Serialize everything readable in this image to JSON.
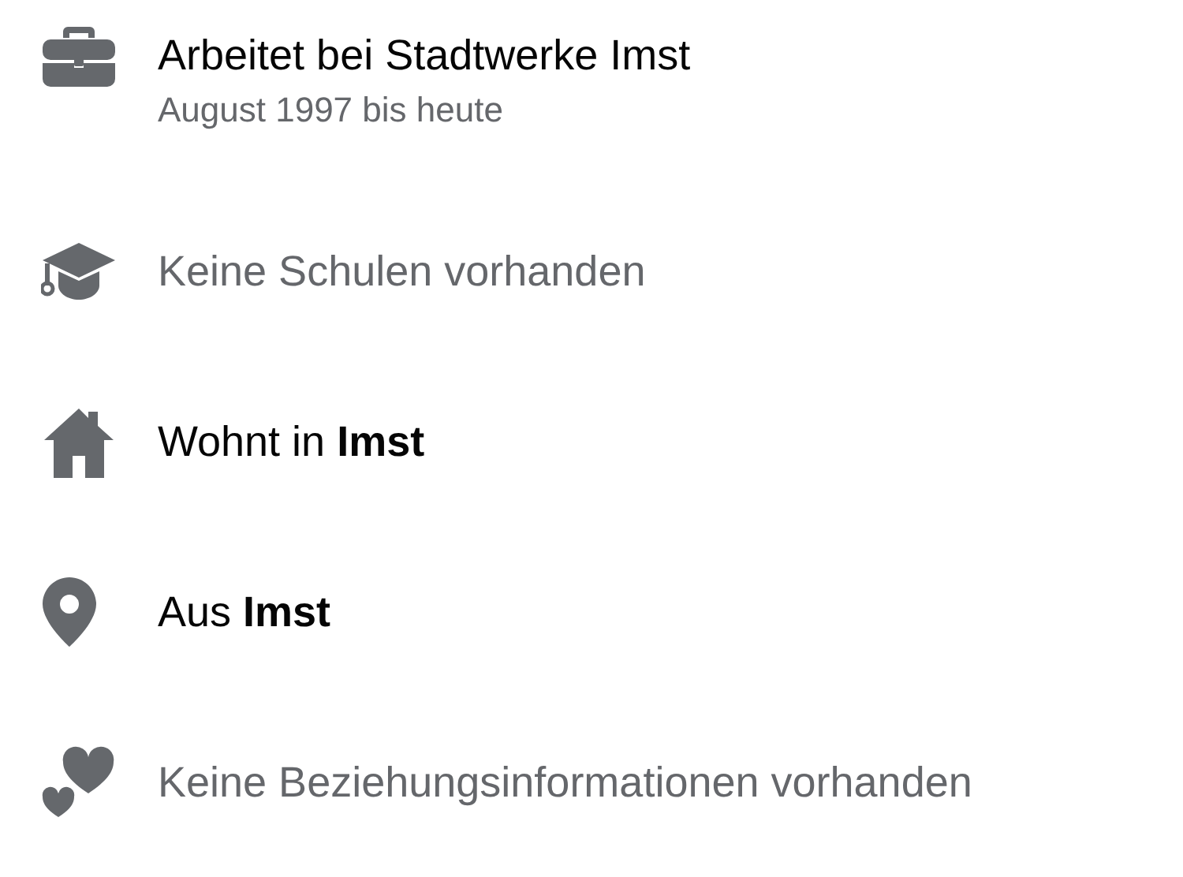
{
  "items": [
    {
      "kind": "work",
      "text": "Arbeitet bei Stadtwerke Imst",
      "muted": false,
      "subtitle": "August 1997 bis heute"
    },
    {
      "kind": "school",
      "text": "Keine Schulen vorhanden",
      "muted": true
    },
    {
      "kind": "home",
      "text": "Wohnt in **Imst**",
      "muted": false
    },
    {
      "kind": "place",
      "text": "Aus **Imst**",
      "muted": false
    },
    {
      "kind": "relationship",
      "text": "Keine Beziehungsinformationen vorhanden",
      "muted": true
    }
  ]
}
